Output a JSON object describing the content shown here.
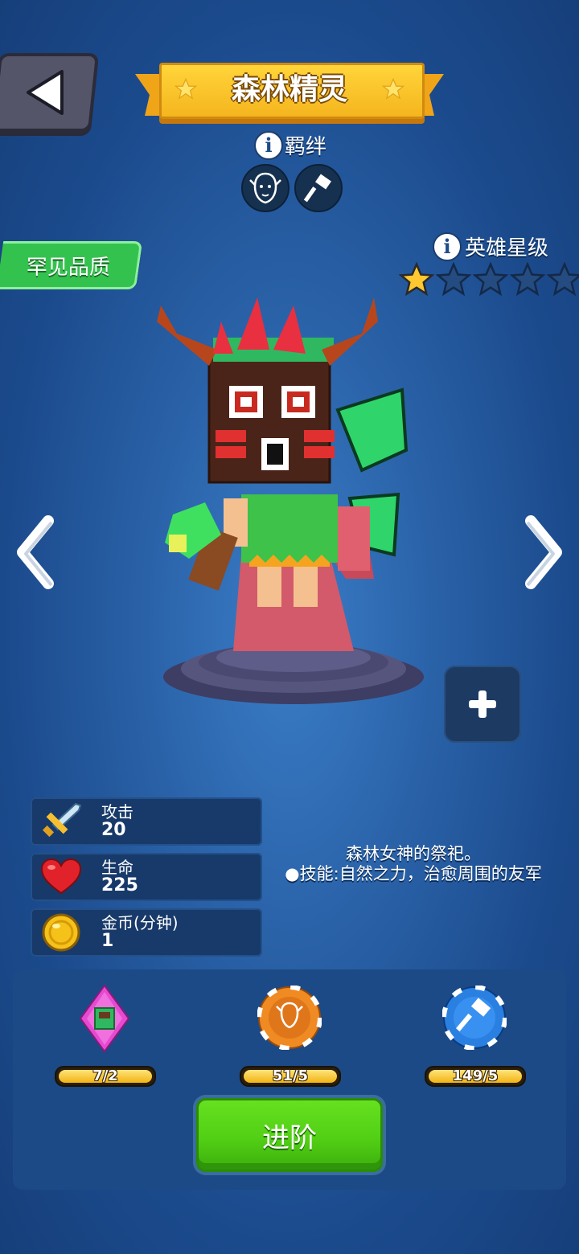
{
  "header": {
    "hero_name": "森林精灵"
  },
  "bond": {
    "label": "羁绊",
    "icons": [
      "elf-face-icon",
      "hammer-icon"
    ]
  },
  "quality": {
    "label": "罕见品质",
    "color": "#34c24e"
  },
  "star_level": {
    "label": "英雄星级",
    "stars_filled": 1,
    "stars_total": 5
  },
  "stats": [
    {
      "label": "攻击",
      "value": "20",
      "icon": "sword-icon"
    },
    {
      "label": "生命",
      "value": "225",
      "icon": "heart-icon"
    },
    {
      "label": "金币(分钟)",
      "value": "1",
      "icon": "gold-coin-icon"
    }
  ],
  "description": {
    "line1": "森林女神的祭祀。",
    "line2": "●技能:自然之力，治愈周围的友军"
  },
  "resources": [
    {
      "icon": "hero-card-gem-icon",
      "text": "7/2"
    },
    {
      "icon": "elf-chip-icon",
      "text": "51/5"
    },
    {
      "icon": "hammer-chip-icon",
      "text": "149/5"
    }
  ],
  "actions": {
    "advance_label": "进阶"
  },
  "colors": {
    "ribbon": "#f5b51e",
    "advance_button": "#52d015",
    "background": "#2a62a8"
  }
}
